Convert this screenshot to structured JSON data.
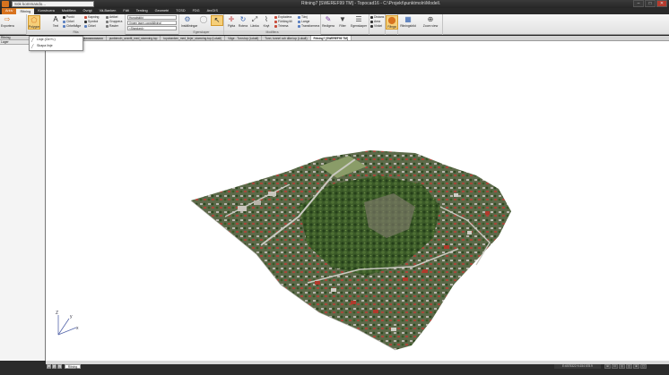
{
  "titlebar": {
    "command_placeholder": "Sök kommando...",
    "title": "Ritning7 [SWEREF99 TM] - Topocad16 - C:\\Projekt\\punktmoln\\Modell.",
    "minimize": "–",
    "maximize": "□",
    "close": "✕"
  },
  "tabs": [
    "Arkiv",
    "Ritning",
    "Konstruera",
    "Modifiera",
    "Övrigt",
    "Vä-Banken",
    "Fält",
    "Terräng",
    "Geometri",
    "TCSD",
    "FDG",
    "ArcGIS"
  ],
  "ribbon": {
    "export_label": "Exportera",
    "drawing_label": "Rita",
    "polygon_label": "Polygon",
    "text_label": "Text",
    "punkt_label": "Punkt",
    "cirkel_label": "Cirkel",
    "cirkelbage_label": "Cirkelbåge",
    "kapning_label": "Kapning",
    "symbol_label": "Symbol",
    "cirkel2_label": "Cirkel",
    "artikel_label": "Artikel",
    "gruppera_label": "Gruppera",
    "raster_label": "Raster",
    "layer_combo": "Huvudskikt",
    "style_combo": "(Ingen lager-uppställning)",
    "layer2_combo": "<Standard>",
    "layer_group": "Lager",
    "egenskaper_group": "Egenskaper",
    "installningar_label": "Inställningar",
    "flytta_label": "Flytta",
    "rotera_label": "Rotera",
    "lanka_label": "Länka",
    "knyt_label": "Knyt",
    "explodera_label": "Explodera",
    "forlang_label": "Förläng till",
    "trimma_label": "Trimma",
    "tanj_label": "Tänj",
    "lange_label": "Lange",
    "transformera_label": "Transformera",
    "redigera_label": "Redigera",
    "filter_label": "Filter",
    "egenskaper_label": "Egenskaper",
    "distans_label": "Distans",
    "area_label": "Area",
    "vinkel_label": "Vinkel",
    "fanga_label": "Fånga",
    "ritningsbild_label": "Ritningsbild",
    "zoom_label": "Zoom view",
    "modify_group": "Modifiera",
    "snap_group": "Fånga"
  },
  "dropdown": {
    "item1": "Linje (Ctrl+L)",
    "item2": "Skapa linje"
  },
  "left_panel": {
    "header": "Lager",
    "header2": "Ritning"
  },
  "doc_tabs": [
    "Ritning",
    "Mellanvägen.aaaaaaaaaaaaaa",
    "punktmoln_avsnitt_med_stomning.top",
    "topobanken_med_linjer_stomning.top (Lokalt)",
    "Väge - Tunn.top (Lokalt)",
    "Tunn, tunnel och dike.top (Lokalt)",
    "Ritning7 [SWEREF99 TM]"
  ],
  "axis": {
    "x": "x",
    "y": "y",
    "z": "Z"
  },
  "sheet_tab": "Ritning",
  "status": {
    "coords": "E:6575322  N:154 678.9",
    "icons": [
      "⊞",
      "⊡",
      "◎",
      "◫",
      "⊕",
      "▢"
    ]
  },
  "colors": {
    "accent": "#d8731f",
    "titlebar": "#2a2a2a",
    "viewport": "#ffffff"
  }
}
